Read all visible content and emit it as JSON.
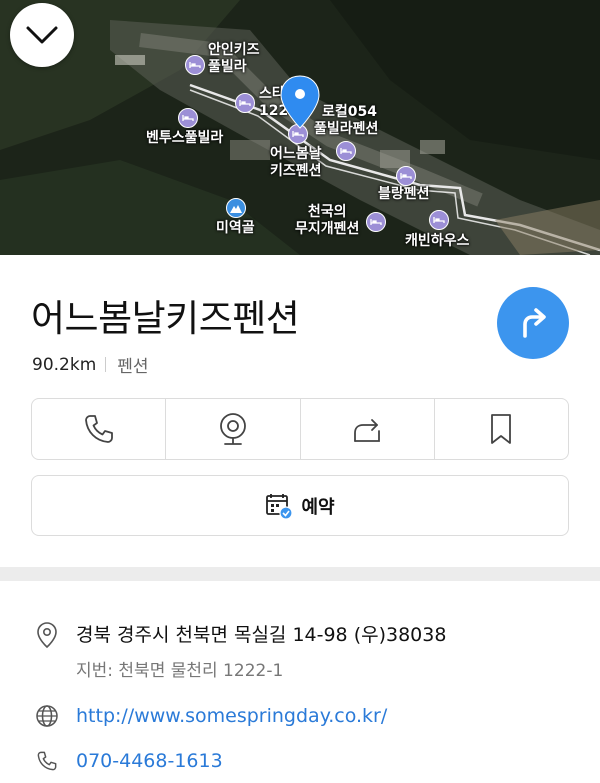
{
  "map": {
    "pois": [
      {
        "name": "aein-kids",
        "lines": [
          "안인키즈",
          "풀빌라"
        ]
      },
      {
        "name": "star",
        "lines": [
          "스타",
          "1222"
        ]
      },
      {
        "name": "local054",
        "lines": [
          "로컬054",
          "풀빌라펜션"
        ]
      },
      {
        "name": "bentus",
        "lines": [
          "벤투스풀빌라"
        ]
      },
      {
        "name": "eoneubomnal",
        "lines": [
          "어느봄날",
          "키즈펜션"
        ]
      },
      {
        "name": "blang",
        "lines": [
          "블랑펜션"
        ]
      },
      {
        "name": "rainbow",
        "lines": [
          "천국의",
          "무지개펜션"
        ]
      },
      {
        "name": "cabin",
        "lines": [
          "캐빈하우스"
        ]
      },
      {
        "name": "miyeokgol",
        "lines": [
          "미역골"
        ]
      }
    ]
  },
  "place": {
    "title": "어느봄날키즈펜션",
    "distance": "90.2km",
    "category": "펜션"
  },
  "actions": {
    "call_icon": "phone-icon",
    "streetview_icon": "webcam-icon",
    "share_icon": "share-icon",
    "save_icon": "bookmark-icon"
  },
  "reserve": {
    "label": "예약",
    "icon": "calendar-check-icon"
  },
  "info": {
    "address": "경북 경주시 천북면 목실길 14-98 (우)38038",
    "jibun": "지번: 천북면 물천리 1222-1",
    "website": "http://www.somespringday.co.kr/",
    "phone": "070-4468-1613"
  },
  "colors": {
    "accent": "#3c95ee",
    "link": "#2a7ad8",
    "poi": "#9c8fd6"
  }
}
